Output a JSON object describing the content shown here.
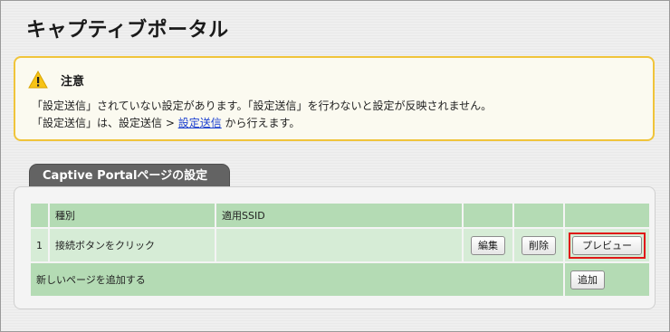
{
  "page": {
    "title": "キャプティブポータル"
  },
  "notice": {
    "title": "注意",
    "line1": "「設定送信」されていない設定があります。「設定送信」を行わないと設定が反映されません。",
    "line2_prefix": "「設定送信」は、設定送信 > ",
    "line2_link": "設定送信",
    "line2_suffix": " から行えます。",
    "accent_color": "#f0c43a"
  },
  "section": {
    "tab_label": "Captive Portalページの設定",
    "table": {
      "headers": {
        "type": "種別",
        "ssid": "適用SSID"
      },
      "rows": [
        {
          "index": "1",
          "type": "接続ボタンをクリック",
          "ssid": "",
          "edit_label": "編集",
          "delete_label": "削除",
          "preview_label": "プレビュー"
        }
      ],
      "add_row": {
        "label": "新しいページを追加する",
        "button_label": "追加"
      }
    },
    "row_color": "#b4dbb4"
  }
}
